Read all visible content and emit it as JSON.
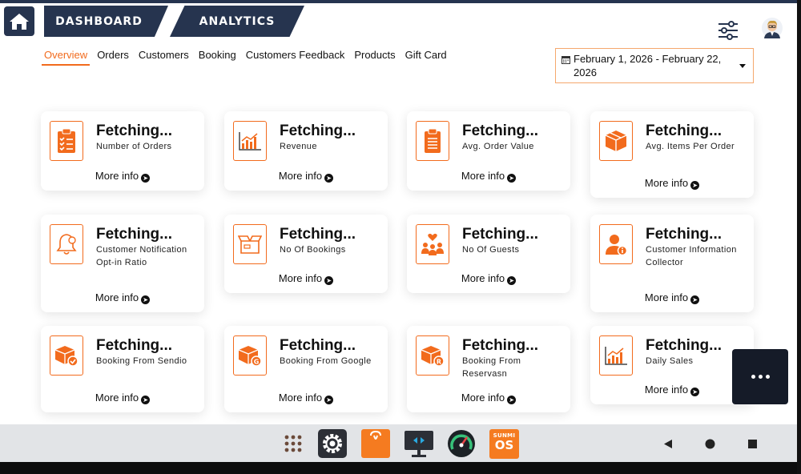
{
  "header": {
    "tabs": [
      {
        "label": "DASHBOARD"
      },
      {
        "label": "ANALYTICS"
      }
    ]
  },
  "subnav": {
    "items": [
      {
        "label": "Overview",
        "active": true
      },
      {
        "label": "Orders"
      },
      {
        "label": "Customers"
      },
      {
        "label": "Booking"
      },
      {
        "label": "Customers Feedback"
      },
      {
        "label": "Products"
      },
      {
        "label": "Gift Card"
      }
    ]
  },
  "date_range": {
    "value": "February 1, 2026 - February 22, 2026"
  },
  "cards": [
    {
      "value": "Fetching...",
      "label": "Number of Orders",
      "link": "More info",
      "icon": "clipboard-list-icon"
    },
    {
      "value": "Fetching...",
      "label": "Revenue",
      "link": "More info",
      "icon": "bar-chart-icon"
    },
    {
      "value": "Fetching...",
      "label": "Avg. Order Value",
      "link": "More info",
      "icon": "clipboard-icon"
    },
    {
      "value": "Fetching...",
      "label": "Avg. Items Per Order",
      "link": "More info",
      "icon": "box-icon"
    },
    {
      "value": "Fetching...",
      "label": "Customer Notification Opt-in Ratio",
      "link": "More info",
      "icon": "bell-icon"
    },
    {
      "value": "Fetching...",
      "label": "No Of Bookings",
      "link": "More info",
      "icon": "open-box-icon"
    },
    {
      "value": "Fetching...",
      "label": "No Of Guests",
      "link": "More info",
      "icon": "guests-icon"
    },
    {
      "value": "Fetching...",
      "label": "Customer Information Collector",
      "link": "More info",
      "icon": "user-info-icon"
    },
    {
      "value": "Fetching...",
      "label": "Booking From Sendio",
      "link": "More info",
      "icon": "box-check-icon"
    },
    {
      "value": "Fetching...",
      "label": "Booking From Google",
      "link": "More info",
      "icon": "box-google-icon"
    },
    {
      "value": "Fetching...",
      "label": "Booking From Reservasn",
      "link": "More info",
      "icon": "box-reservasn-icon"
    },
    {
      "value": "Fetching...",
      "label": "Daily Sales",
      "link": "More info",
      "icon": "sales-chart-icon"
    }
  ],
  "taskbar": {
    "apps": [
      "app-grid-icon",
      "settings-icon",
      "shopping-bag-icon",
      "remote-desktop-icon",
      "speedometer-icon",
      "sunmi-os-icon"
    ],
    "sunmi_label_top": "SUNMI",
    "sunmi_label_bottom": "OS"
  },
  "colors": {
    "navy": "#26344f",
    "accent": "#f26b1d"
  }
}
